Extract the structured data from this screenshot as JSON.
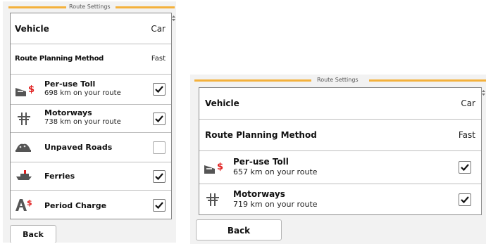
{
  "colors": {
    "accent_line": "#f4b13c",
    "money_red": "#e02020",
    "icon_gray": "#555555"
  },
  "left": {
    "title": "Route Settings",
    "rows": [
      {
        "label": "Vehicle",
        "value": "Car"
      },
      {
        "label": "Route Planning Method",
        "value": "Fast"
      },
      {
        "label": "Per-use Toll",
        "distance": "698 km",
        "suffix": "on your route",
        "icon": "per-use-toll-icon",
        "checked": true
      },
      {
        "label": "Motorways",
        "distance": "738 km",
        "suffix": "on your route",
        "icon": "motorway-icon",
        "checked": true
      },
      {
        "label": "Unpaved Roads",
        "icon": "unpaved-road-icon",
        "checked": false
      },
      {
        "label": "Ferries",
        "icon": "ferry-icon",
        "checked": true
      },
      {
        "label": "Period Charge",
        "icon": "period-charge-icon",
        "checked": true
      }
    ],
    "back_label": "Back"
  },
  "right": {
    "title": "Route Settings",
    "rows": [
      {
        "label": "Vehicle",
        "value": "Car"
      },
      {
        "label": "Route Planning Method",
        "value": "Fast"
      },
      {
        "label": "Per-use Toll",
        "distance": "657 km",
        "suffix": "on your route",
        "icon": "per-use-toll-icon",
        "checked": true
      },
      {
        "label": "Motorways",
        "distance": "719 km",
        "suffix": "on your route",
        "icon": "motorway-icon",
        "checked": true
      }
    ],
    "back_label": "Back"
  }
}
